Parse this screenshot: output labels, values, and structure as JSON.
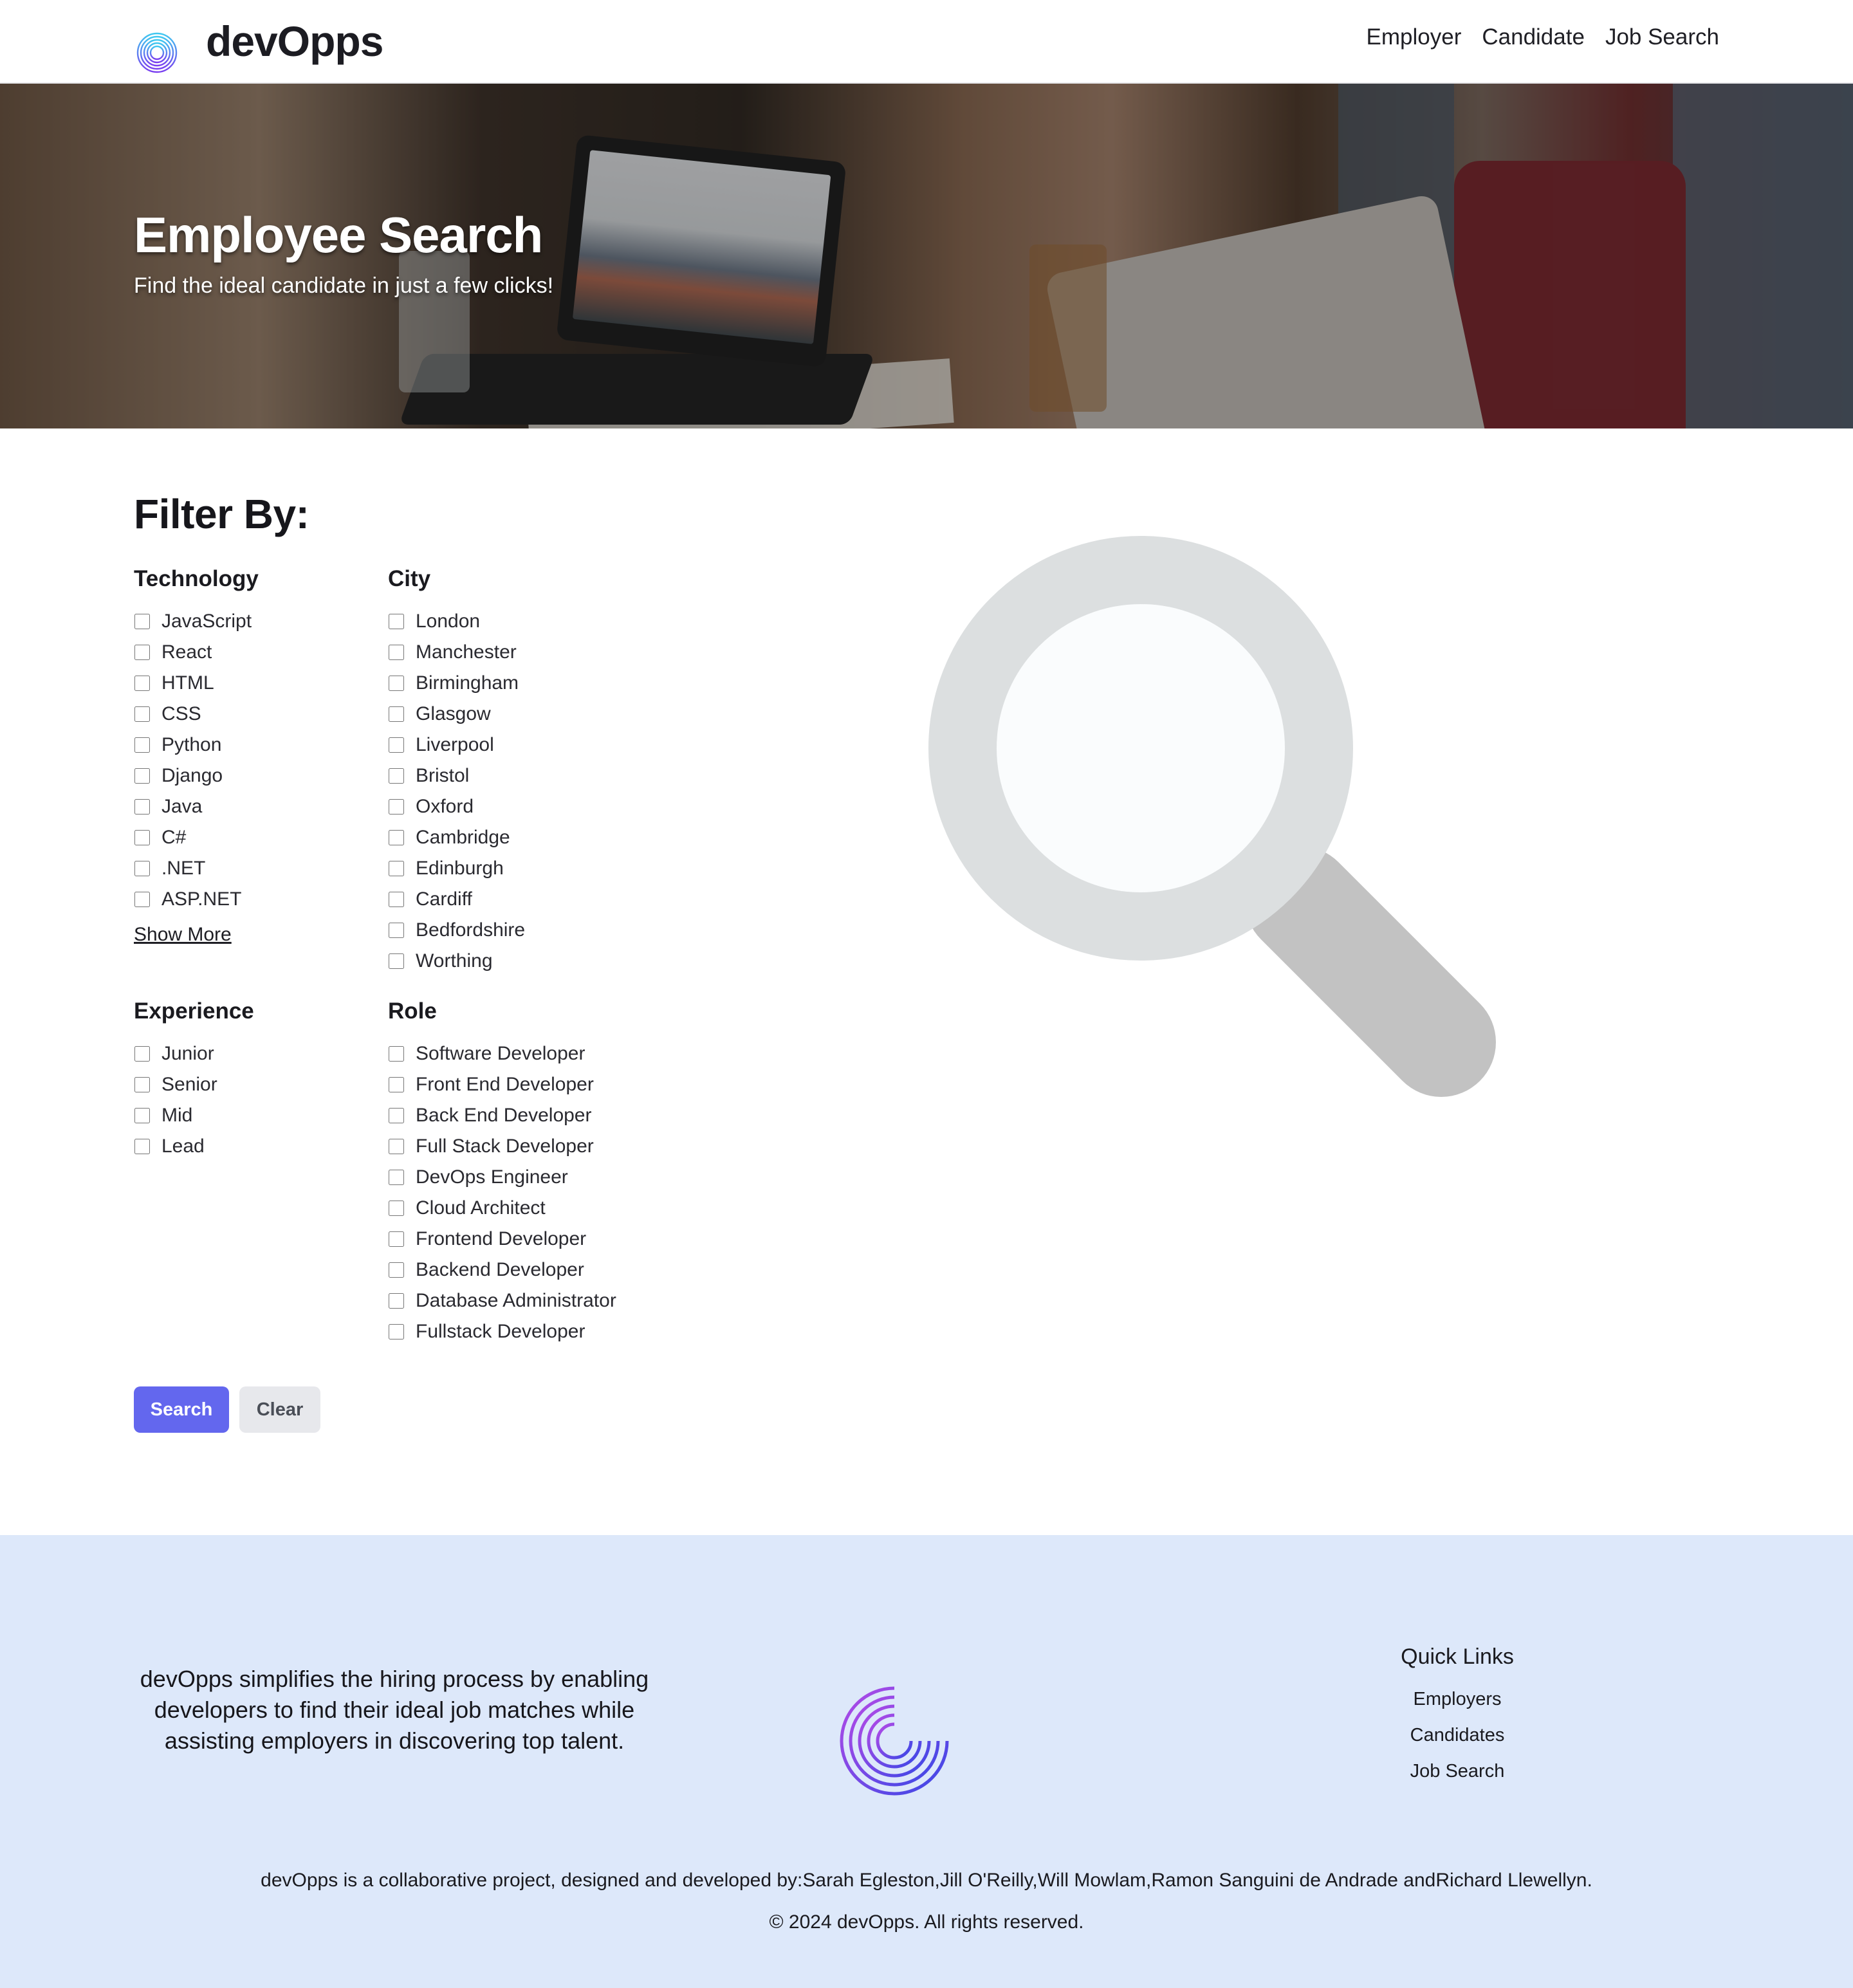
{
  "brand": {
    "name": "devOpps"
  },
  "nav": {
    "items": [
      "Employer",
      "Candidate",
      "Job Search"
    ]
  },
  "hero": {
    "title": "Employee Search",
    "subtitle": "Find the ideal candidate in just a few clicks!"
  },
  "filters": {
    "heading": "Filter By:",
    "technology": {
      "title": "Technology",
      "options": [
        "JavaScript",
        "React",
        "HTML",
        "CSS",
        "Python",
        "Django",
        "Java",
        "C#",
        ".NET",
        "ASP.NET"
      ],
      "show_more": "Show More"
    },
    "city": {
      "title": "City",
      "options": [
        "London",
        "Manchester",
        "Birmingham",
        "Glasgow",
        "Liverpool",
        "Bristol",
        "Oxford",
        "Cambridge",
        "Edinburgh",
        "Cardiff",
        "Bedfordshire",
        "Worthing"
      ]
    },
    "experience": {
      "title": "Experience",
      "options": [
        "Junior",
        "Senior",
        "Mid",
        "Lead"
      ]
    },
    "role": {
      "title": "Role",
      "options": [
        "Software Developer",
        "Front End Developer",
        "Back End Developer",
        "Full Stack Developer",
        "DevOps Engineer",
        "Cloud Architect",
        "Frontend Developer",
        "Backend Developer",
        "Database Administrator",
        "Fullstack Developer"
      ]
    }
  },
  "actions": {
    "search": "Search",
    "clear": "Clear"
  },
  "footer": {
    "about": "devOpps simplifies the hiring process by enabling developers to find their ideal job matches while assisting employers in discovering top talent.",
    "quick_links": {
      "title": "Quick Links",
      "items": [
        "Employers",
        "Candidates",
        "Job Search"
      ]
    },
    "credits": "devOpps is a collaborative project, designed and developed by:Sarah Egleston,Jill O'Reilly,Will Mowlam,Ramon Sanguini de Andrade andRichard Llewellyn.",
    "copyright": "© 2024 devOpps. All rights reserved."
  },
  "colors": {
    "accent": "#6367ee",
    "footer_bg": "#dde8fa",
    "magnifier_ring": "#dcdfe0",
    "magnifier_handle": "#c2c2c2"
  },
  "icons": [
    "devopps-logo-icon",
    "magnifier-icon"
  ]
}
